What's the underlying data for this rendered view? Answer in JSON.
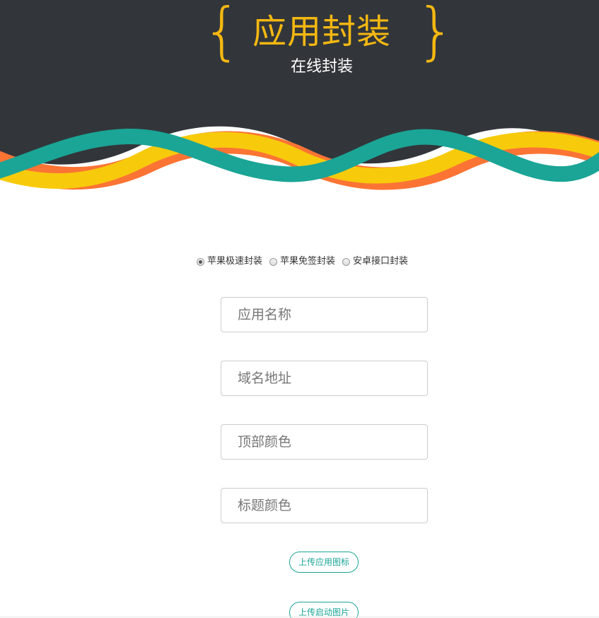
{
  "header": {
    "brace_left": "{",
    "title": "应用封装",
    "brace_right": "}",
    "subtitle": "在线封装"
  },
  "colors": {
    "header_bg": "#32363a",
    "title_color": "#f5b812",
    "wave_teal": "#1aa596",
    "wave_yellow": "#f7cb0c",
    "wave_orange": "#fb7434"
  },
  "pack_type": {
    "selected": "苹果极速封装",
    "options": [
      {
        "label": "苹果极速封装",
        "checked": true
      },
      {
        "label": "苹果免签封装",
        "checked": false
      },
      {
        "label": "安卓接口封装",
        "checked": false
      }
    ]
  },
  "form": {
    "app_name": {
      "placeholder": "应用名称",
      "value": ""
    },
    "domain": {
      "placeholder": "域名地址",
      "value": ""
    },
    "top_color": {
      "placeholder": "顶部颜色",
      "value": ""
    },
    "title_color": {
      "placeholder": "标题颜色",
      "value": ""
    }
  },
  "buttons": {
    "upload_icon": "上传应用图标",
    "upload_splash": "上传启动图片"
  }
}
